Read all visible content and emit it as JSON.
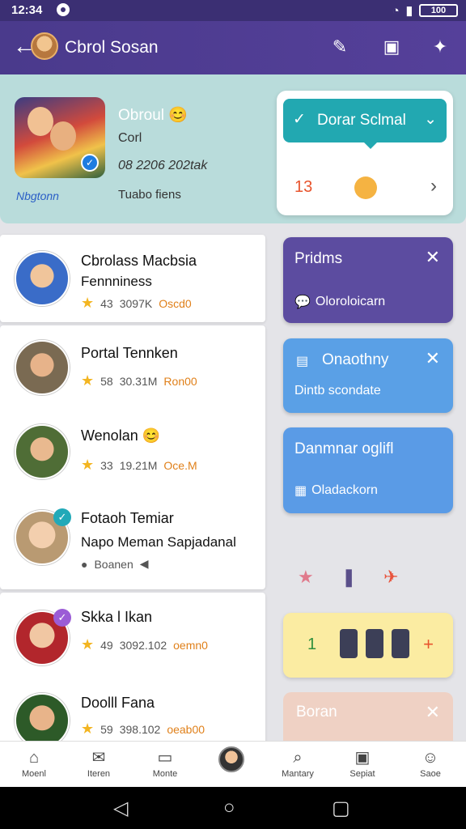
{
  "status_bar": {
    "time": "12:34",
    "battery": "100"
  },
  "app_bar": {
    "back_icon": "←",
    "title": "Cbrol Sosan",
    "actions": [
      "pin-icon",
      "bookmark-icon",
      "star-icon"
    ]
  },
  "profile": {
    "name": "Obroul",
    "line1": "Corl",
    "line2": "08 2206 202tak",
    "line3": "Tuabo fiens",
    "photo_caption": "Nbgtonn"
  },
  "selector_card": {
    "dropdown_label": "Dorar Sclmal",
    "count": "13",
    "next_icon": "›"
  },
  "contacts": [
    {
      "name": "Cbrolass Macbsia",
      "subtitle": "Fennniness",
      "rating": "43",
      "stat": "3097K",
      "tag": "Oscd0",
      "avatar_color": "#3a6cc8"
    },
    {
      "name": "Portal Tennken",
      "subtitle": "",
      "rating": "58",
      "stat": "30.31M",
      "tag": "Ron00",
      "avatar_color": "#7a6a52"
    },
    {
      "name": "Wenolan",
      "subtitle": "",
      "rating": "33",
      "stat": "19.21M",
      "tag": "Oce.M",
      "avatar_color": "#4f6d36"
    },
    {
      "name": "Fotaoh Temiar",
      "subtitle": "Napo Meman Sapjadanal",
      "rating": "",
      "stat": "",
      "tag": "Boanen",
      "avatar_color": "#b99a72"
    },
    {
      "name": "Skka l Ikan",
      "subtitle": "",
      "rating": "49",
      "stat": "3092.102",
      "tag": "oemn0",
      "avatar_color": "#b2262c"
    },
    {
      "name": "Doolll Fana",
      "subtitle": "",
      "rating": "59",
      "stat": "398.102",
      "tag": "oeab00",
      "avatar_color": "#2d5a28"
    }
  ],
  "side_cards": [
    {
      "title": "Pridms",
      "body": "Oloroloicarn",
      "color": "#5c4ca0",
      "closable": true
    },
    {
      "title": "Onaothny",
      "body": "Dintb scondate",
      "color": "#5aa0e6",
      "closable": true
    },
    {
      "title": "Danmnar oglifl",
      "body": "Oladackorn",
      "color": "#5a9be6",
      "closable": false
    }
  ],
  "yellow_card": {
    "count": "1",
    "add_icon": "+"
  },
  "peach_card": {
    "title": "Boran"
  },
  "bottom_nav": [
    {
      "label": "Moenl",
      "icon": "home-icon"
    },
    {
      "label": "Iteren",
      "icon": "send-icon"
    },
    {
      "label": "Monte",
      "icon": "image-icon"
    },
    {
      "label": "",
      "icon": "profile-avatar"
    },
    {
      "label": "Mantary",
      "icon": "search-icon"
    },
    {
      "label": "Sepiat",
      "icon": "camera-icon"
    },
    {
      "label": "Saoe",
      "icon": "person-icon"
    }
  ]
}
